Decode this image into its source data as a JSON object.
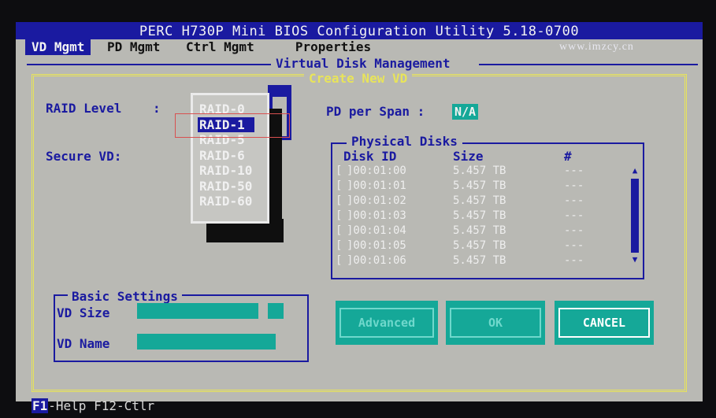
{
  "title": "PERC H730P Mini BIOS Configuration Utility 5.18-0700",
  "watermark": "www.imzcy.cn",
  "menu": [
    {
      "label": "VD Mgmt",
      "active": true
    },
    {
      "label": "PD Mgmt",
      "active": false
    },
    {
      "label": "Ctrl Mgmt",
      "active": false
    },
    {
      "label": "Properties",
      "active": false
    }
  ],
  "panel_title": "Virtual Disk Management",
  "dialog_title": "Create New VD",
  "raid": {
    "label": "RAID Level",
    "colon": ":",
    "options": [
      "RAID-0",
      "RAID-1",
      "RAID-5",
      "RAID-6",
      "RAID-10",
      "RAID-50",
      "RAID-60"
    ],
    "selected": "RAID-1"
  },
  "secure_vd_label": "Secure VD:",
  "pd_per_span": {
    "label": "PD per Span :",
    "value": "N/A"
  },
  "physical_disks": {
    "title": "Physical Disks",
    "headers": {
      "disk_id": "Disk ID",
      "size": "Size",
      "num": "#"
    },
    "rows": [
      {
        "check": "[",
        "disk_id": "]00:01:00",
        "size": "5.457 TB",
        "num": "---"
      },
      {
        "check": "[",
        "disk_id": "]00:01:01",
        "size": "5.457 TB",
        "num": "---"
      },
      {
        "check": "[",
        "disk_id": "]00:01:02",
        "size": "5.457 TB",
        "num": "---"
      },
      {
        "check": "[",
        "disk_id": "]00:01:03",
        "size": "5.457 TB",
        "num": "---"
      },
      {
        "check": "[",
        "disk_id": "]00:01:04",
        "size": "5.457 TB",
        "num": "---"
      },
      {
        "check": "[",
        "disk_id": "]00:01:05",
        "size": "5.457 TB",
        "num": "---"
      },
      {
        "check": "[",
        "disk_id": "]00:01:06",
        "size": "5.457 TB",
        "num": "---"
      }
    ],
    "scroll_up_glyph": "▲",
    "scroll_down_glyph": "▼"
  },
  "basic_settings": {
    "title": "Basic Settings",
    "vd_size_label": "VD Size",
    "vd_name_label": "VD Name"
  },
  "buttons": {
    "advanced": "Advanced",
    "ok": "OK",
    "cancel": "CANCEL"
  },
  "footer": {
    "f1": "F1",
    "help": "-Help F12-Ctlr"
  },
  "colors": {
    "bios_blue": "#1a1aa0",
    "teal": "#15a898",
    "dialog_yellow": "#e8e45a",
    "gray": "#b9b9b4"
  }
}
